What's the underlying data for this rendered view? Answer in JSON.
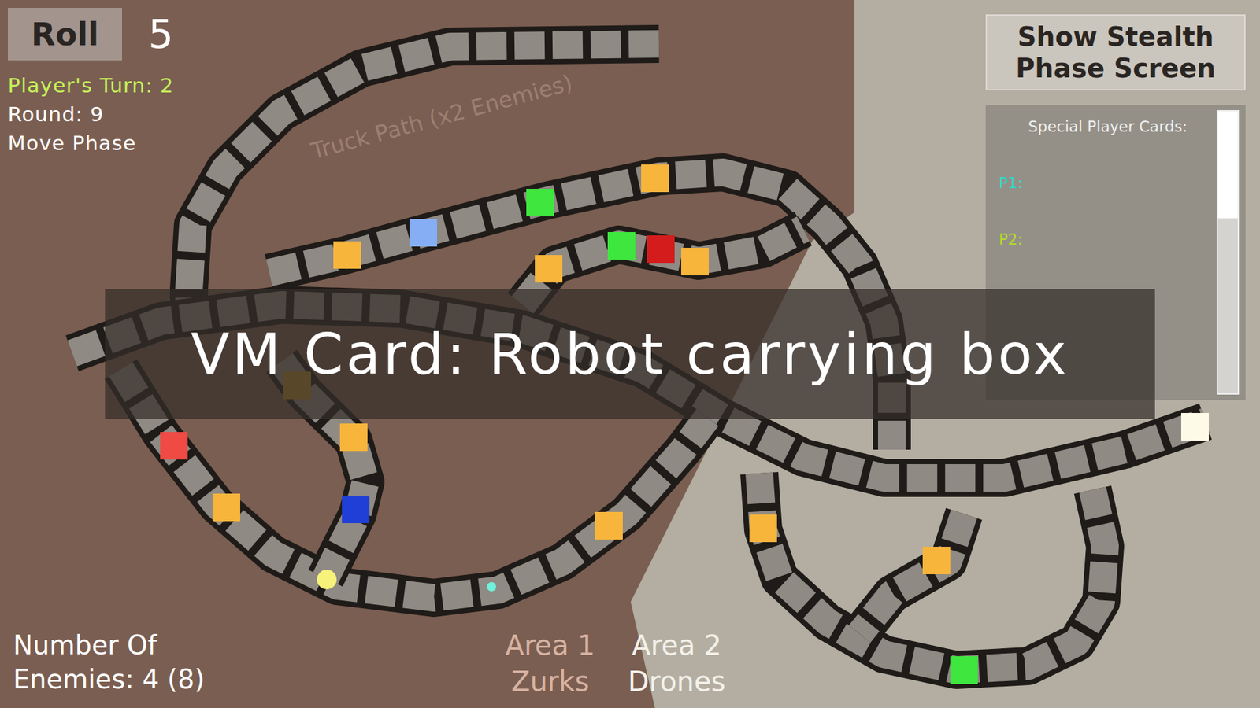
{
  "hud": {
    "roll_button": "Roll",
    "roll_value": "5",
    "player_turn": "Player's Turn: 2",
    "round": "Round: 9",
    "phase": "Move Phase",
    "enemies": "Number Of Enemies: 4 (8)"
  },
  "stealth_button": "Show Stealth Phase Screen",
  "cards_panel": {
    "title": "Special Player Cards:",
    "players": [
      {
        "label": "P1:",
        "color": "#2fd9c4"
      },
      {
        "label": "P2:",
        "color": "#b5dc2a"
      }
    ],
    "scroll_level": 0.38
  },
  "banner": "VM Card: Robot carrying box",
  "board": {
    "path_label": "Truck Path (x2 Enemies)",
    "areas": [
      {
        "label": "Area 1",
        "name": "Zurks",
        "color": "#d8b2a2"
      },
      {
        "label": "Area 2",
        "name": "Drones",
        "color": "#f4f1ea"
      }
    ],
    "special_tiles": [
      {
        "color": "#f7b53c"
      },
      {
        "color": "#f7b53c"
      },
      {
        "color": "#f7b53c"
      },
      {
        "color": "#f7b53c"
      },
      {
        "color": "#f7b53c"
      },
      {
        "color": "#f7b53c"
      },
      {
        "color": "#f7b53c"
      },
      {
        "color": "#f7b53c"
      },
      {
        "color": "#f7b53c"
      },
      {
        "color": "#86aef5"
      },
      {
        "color": "#3ee63e"
      },
      {
        "color": "#3ee63e"
      },
      {
        "color": "#3ee63e"
      },
      {
        "color": "#d41c1c"
      },
      {
        "color": "#f04a44"
      },
      {
        "color": "#1f3fd6"
      },
      {
        "color": "#b68a2a"
      },
      {
        "color": "#fdfbe8"
      }
    ],
    "tokens": [
      {
        "player": "P2",
        "color": "#f6f27a"
      },
      {
        "player": "P1",
        "color": "#6ff2dc"
      }
    ]
  }
}
